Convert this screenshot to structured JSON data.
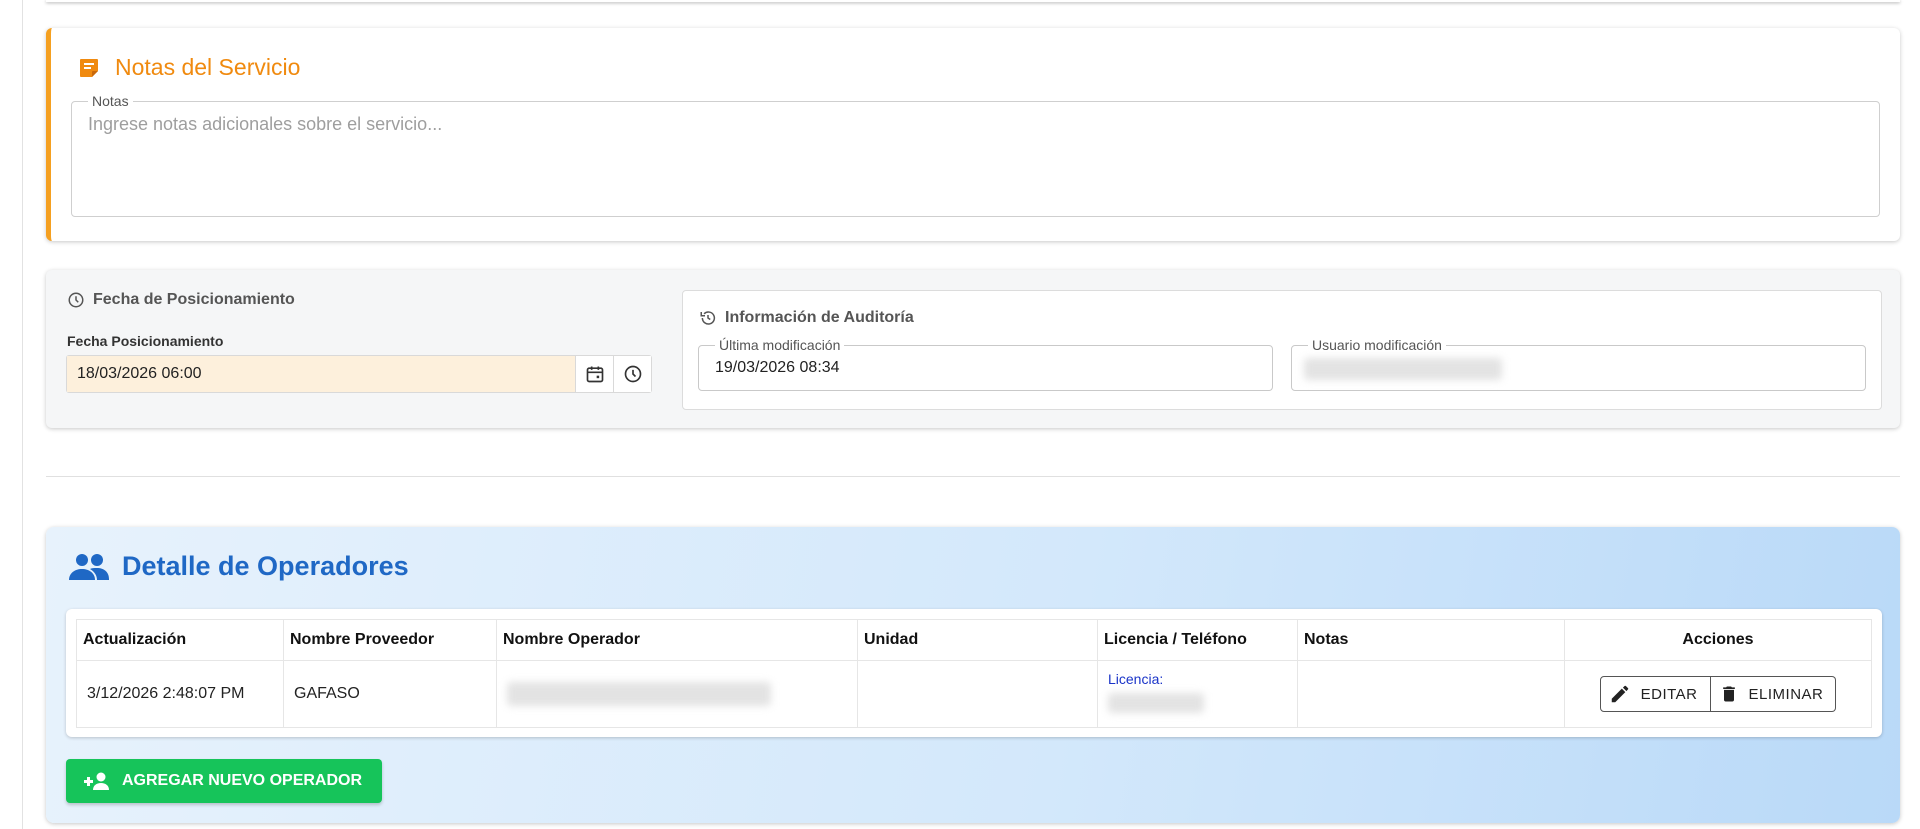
{
  "colors": {
    "notes_accent": "#f08a0f",
    "ops_title": "#1f68c5",
    "add_button": "#16c45a",
    "license_label": "#1a34c8"
  },
  "notes": {
    "title": "Notas del Servicio",
    "field_legend": "Notas",
    "placeholder": "Ingrese notas adicionales sobre el servicio...",
    "icon": "sticky-note-icon"
  },
  "positioning": {
    "title": "Fecha de Posicionamiento",
    "label": "Fecha Posicionamiento",
    "value": "18/03/2026 06:00",
    "icons": [
      "clock-icon",
      "calendar-icon",
      "clock-icon"
    ]
  },
  "audit": {
    "title": "Información de Auditoría",
    "last_modified_label": "Última modificación",
    "last_modified_value": "19/03/2026 08:34",
    "user_label": "Usuario modificación",
    "icon": "history-icon"
  },
  "operators": {
    "title": "Detalle de Operadores",
    "icon": "people-icon",
    "columns": [
      "Actualización",
      "Nombre Proveedor",
      "Nombre Operador",
      "Unidad",
      "Licencia / Teléfono",
      "Notas",
      "Acciones"
    ],
    "rows": [
      {
        "updated": "3/12/2026 2:48:07 PM",
        "provider": "GAFASO",
        "unit": "",
        "license_label": "Licencia:",
        "notes": ""
      }
    ],
    "edit_label": "EDITAR",
    "delete_label": "ELIMINAR",
    "add_label": "AGREGAR NUEVO OPERADOR"
  }
}
